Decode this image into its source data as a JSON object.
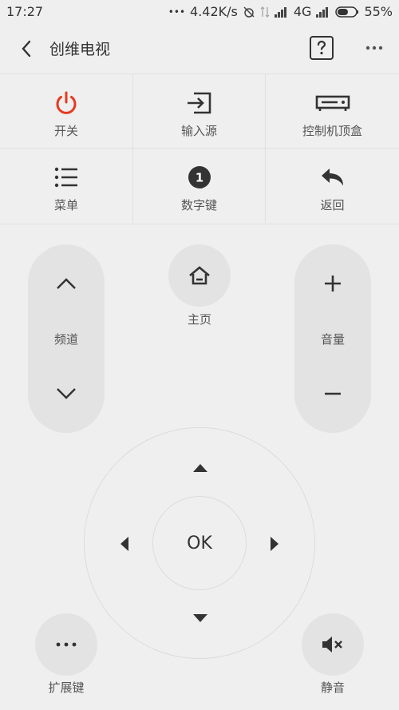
{
  "status": {
    "time": "17:27",
    "dots": "•••",
    "speed": "4.42K/s",
    "network": "4G",
    "battery": "55%"
  },
  "header": {
    "title": "创维电视"
  },
  "grid": [
    {
      "label": "开关",
      "icon": "power-icon"
    },
    {
      "label": "输入源",
      "icon": "input-source-icon"
    },
    {
      "label": "控制机顶盒",
      "icon": "set-top-box-icon"
    },
    {
      "label": "菜单",
      "icon": "menu-list-icon"
    },
    {
      "label": "数字键",
      "icon": "number-keys-icon"
    },
    {
      "label": "返回",
      "icon": "return-icon"
    }
  ],
  "number_icon_text": "1",
  "channel": {
    "label": "频道"
  },
  "home": {
    "label": "主页"
  },
  "volume": {
    "label": "音量"
  },
  "dpad": {
    "ok_label": "OK"
  },
  "extend": {
    "label": "扩展键"
  },
  "mute": {
    "label": "静音"
  },
  "colors": {
    "power": "#e8391f",
    "background": "#efefef",
    "button": "#e3e3e3",
    "icon": "#333333"
  }
}
